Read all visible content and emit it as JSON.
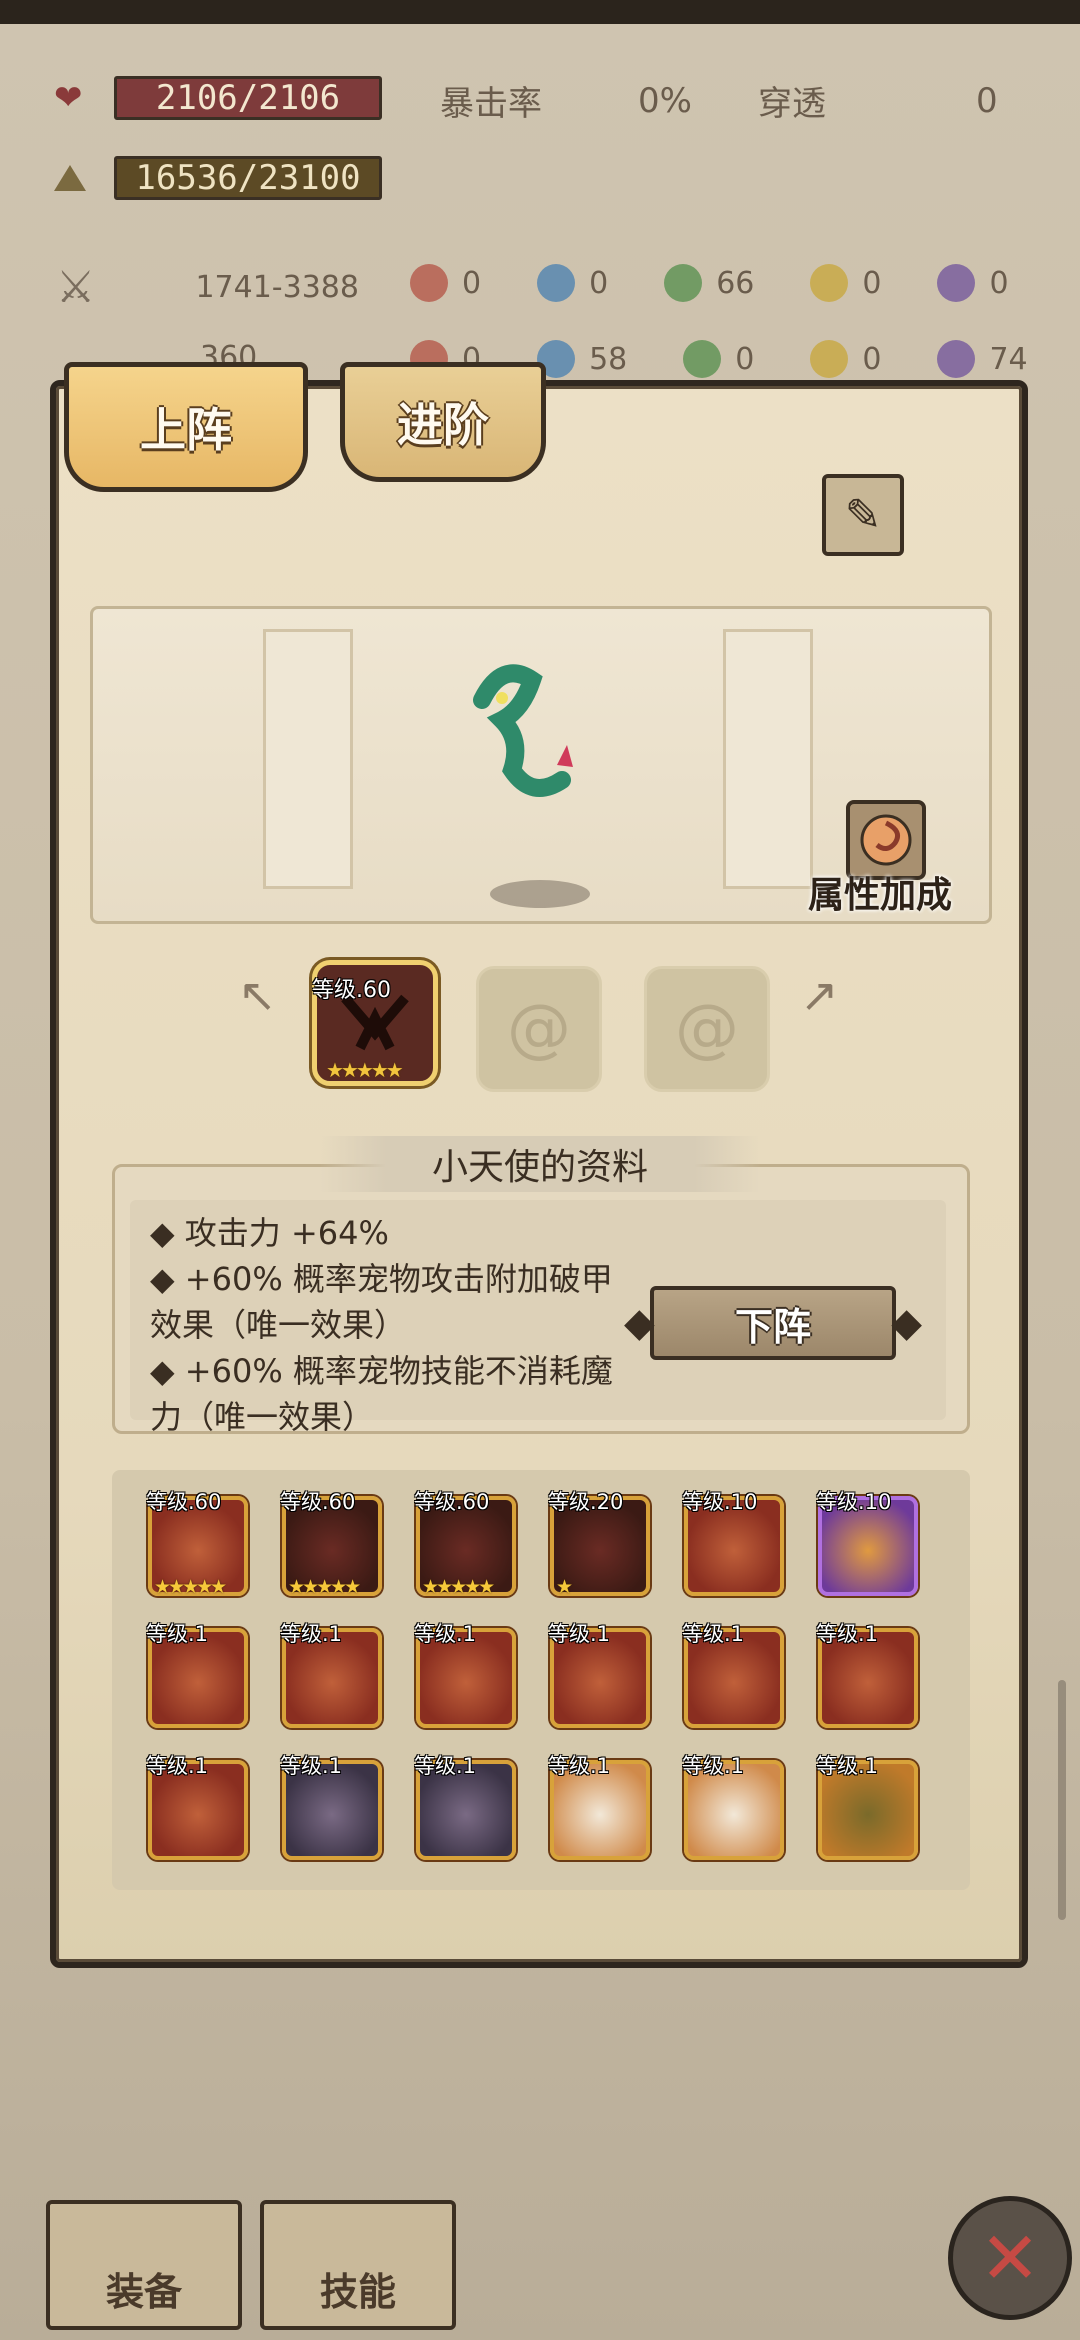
{
  "stats": {
    "hp": "2106/2106",
    "xp": "16536/23100",
    "crit_label": "暴击率",
    "crit_value": "0%",
    "pierce_label": "穿透",
    "pierce_value": "0",
    "attack": "1741-3388",
    "defense": "360",
    "atk_elements": [
      "0",
      "0",
      "66",
      "0",
      "0"
    ],
    "def_elements": [
      "0",
      "58",
      "0",
      "0",
      "74"
    ]
  },
  "tabs": {
    "deploy": "上阵",
    "advance": "进阶"
  },
  "attr_bonus_label": "属性加成",
  "slots": {
    "active_level": "等级.60",
    "active_stars": "★★★★★"
  },
  "info": {
    "title": "小天使的资料",
    "lines": [
      "◆ 攻击力 +64%",
      "◆  +60% 概率宠物攻击附加破甲",
      "    效果（唯一效果）",
      "◆  +60% 概率宠物技能不消耗魔",
      "    力（唯一效果）"
    ],
    "undeploy_button": "下阵"
  },
  "pets": [
    {
      "level": "等级.60",
      "stars": "★★★★★",
      "kind": "fruit"
    },
    {
      "level": "等级.60",
      "stars": "★★★★★",
      "kind": "dragon"
    },
    {
      "level": "等级.60",
      "stars": "★★★★★",
      "kind": "dragon"
    },
    {
      "level": "等级.20",
      "stars": "★",
      "kind": "dragon"
    },
    {
      "level": "等级.10",
      "stars": "",
      "kind": "fruit"
    },
    {
      "level": "等级.10",
      "stars": "",
      "kind": "purple"
    },
    {
      "level": "等级.1",
      "stars": "",
      "kind": "fruit"
    },
    {
      "level": "等级.1",
      "stars": "",
      "kind": "fruit"
    },
    {
      "level": "等级.1",
      "stars": "",
      "kind": "fruit"
    },
    {
      "level": "等级.1",
      "stars": "",
      "kind": "fruit"
    },
    {
      "level": "等级.1",
      "stars": "",
      "kind": "fruit"
    },
    {
      "level": "等级.1",
      "stars": "",
      "kind": "fruit"
    },
    {
      "level": "等级.1",
      "stars": "",
      "kind": "fruit"
    },
    {
      "level": "等级.1",
      "stars": "",
      "kind": "rock"
    },
    {
      "level": "等级.1",
      "stars": "",
      "kind": "rock"
    },
    {
      "level": "等级.1",
      "stars": "",
      "kind": "angel"
    },
    {
      "level": "等级.1",
      "stars": "",
      "kind": "angel"
    },
    {
      "level": "等级.1",
      "stars": "",
      "kind": "plant"
    }
  ],
  "bottom_nav": {
    "equip": "装备",
    "skill": "技能"
  },
  "icons": [
    "heart-icon",
    "triangle-icon",
    "sword-icon",
    "brush-icon",
    "attr-bonus-icon",
    "close-icon"
  ]
}
